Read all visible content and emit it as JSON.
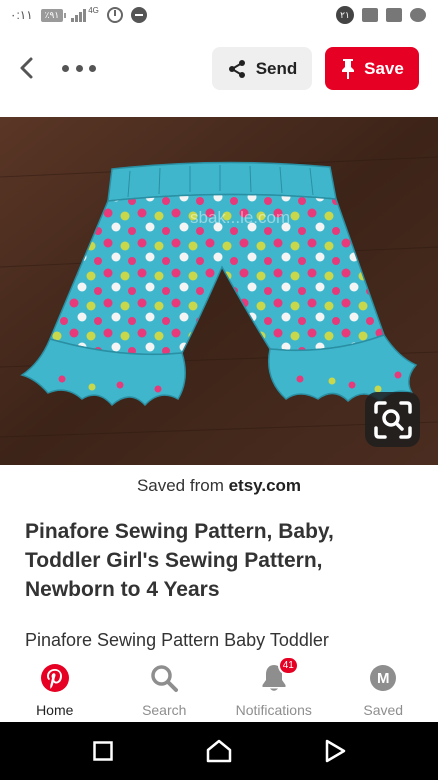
{
  "status_bar": {
    "time": "٠:١١",
    "battery": "٪٩١",
    "network": "4G",
    "notif_count": "٢١"
  },
  "header": {
    "send_label": "Send",
    "save_label": "Save"
  },
  "pin": {
    "image_watermark": "sbak...le.com",
    "saved_from_prefix": "Saved from ",
    "saved_from_domain": "etsy.com",
    "title": "Pinafore Sewing Pattern, Baby, Toddler Girl's Sewing Pattern, Newborn to 4 Years",
    "description": "Pinafore Sewing Pattern Baby Toddler"
  },
  "bottom_nav": {
    "items": [
      {
        "label": "Home",
        "icon": "pinterest-logo-icon"
      },
      {
        "label": "Search",
        "icon": "search-icon"
      },
      {
        "label": "Notifications",
        "icon": "bell-icon",
        "badge": "41"
      },
      {
        "label": "Saved",
        "icon": "avatar",
        "avatar_letter": "M"
      }
    ]
  },
  "colors": {
    "brand_red": "#e60023",
    "send_bg": "#efefef",
    "shorts_teal": "#3fb6cc"
  }
}
